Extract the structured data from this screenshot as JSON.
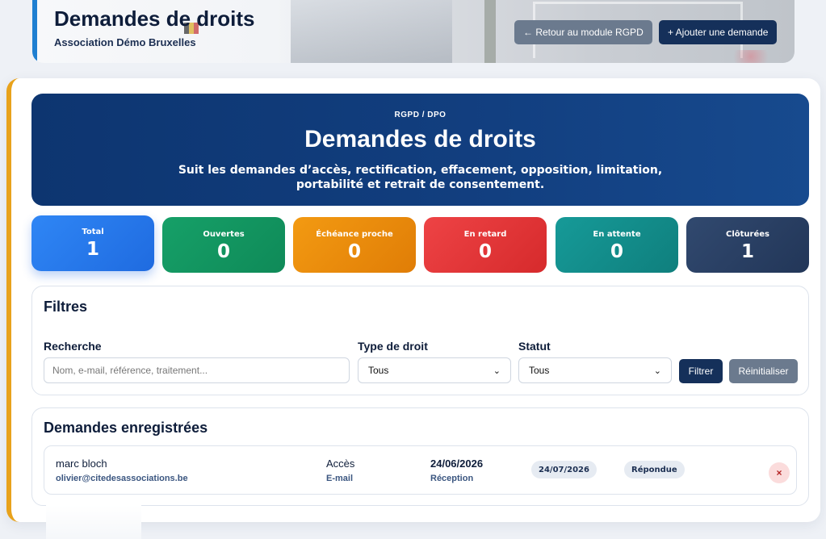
{
  "header": {
    "title": "Demandes de droits",
    "subtitle": "Association Démo Bruxelles",
    "back_label": "← Retour au module RGPD",
    "add_label": "+ Ajouter une demande",
    "accent": "#1f7fd1"
  },
  "hero": {
    "eyebrow": "RGPD / DPO",
    "title": "Demandes de droits",
    "description": "Suit les demandes d’accès, rectification, effacement, opposition, limitation, portabilité et retrait de consentement."
  },
  "stats": [
    {
      "label": "Total",
      "value": "1",
      "color": "#2f7ff0"
    },
    {
      "label": "Ouvertes",
      "value": "0",
      "color": "#12985f"
    },
    {
      "label": "Échéance proche",
      "value": "0",
      "color": "#ee8e0c"
    },
    {
      "label": "En retard",
      "value": "0",
      "color": "#e33638"
    },
    {
      "label": "En attente",
      "value": "0",
      "color": "#13918f"
    },
    {
      "label": "Clôturées",
      "value": "1",
      "color": "#2a4166"
    }
  ],
  "filters": {
    "title": "Filtres",
    "search_label": "Recherche",
    "search_placeholder": "Nom, e-mail, référence, traitement...",
    "type_label": "Type de droit",
    "type_value": "Tous",
    "status_label": "Statut",
    "status_value": "Tous",
    "filter_button": "Filtrer",
    "reset_button": "Réinitialiser"
  },
  "records": {
    "title": "Demandes enregistrées",
    "rows": [
      {
        "name": "marc bloch",
        "email": "olivier@citedesassociations.be",
        "right_type": "Accès",
        "channel": "E-mail",
        "date": "24/06/2026",
        "date_label": "Réception",
        "deadline": "24/07/2026",
        "status": "Répondue",
        "delete_glyph": "×"
      }
    ]
  }
}
